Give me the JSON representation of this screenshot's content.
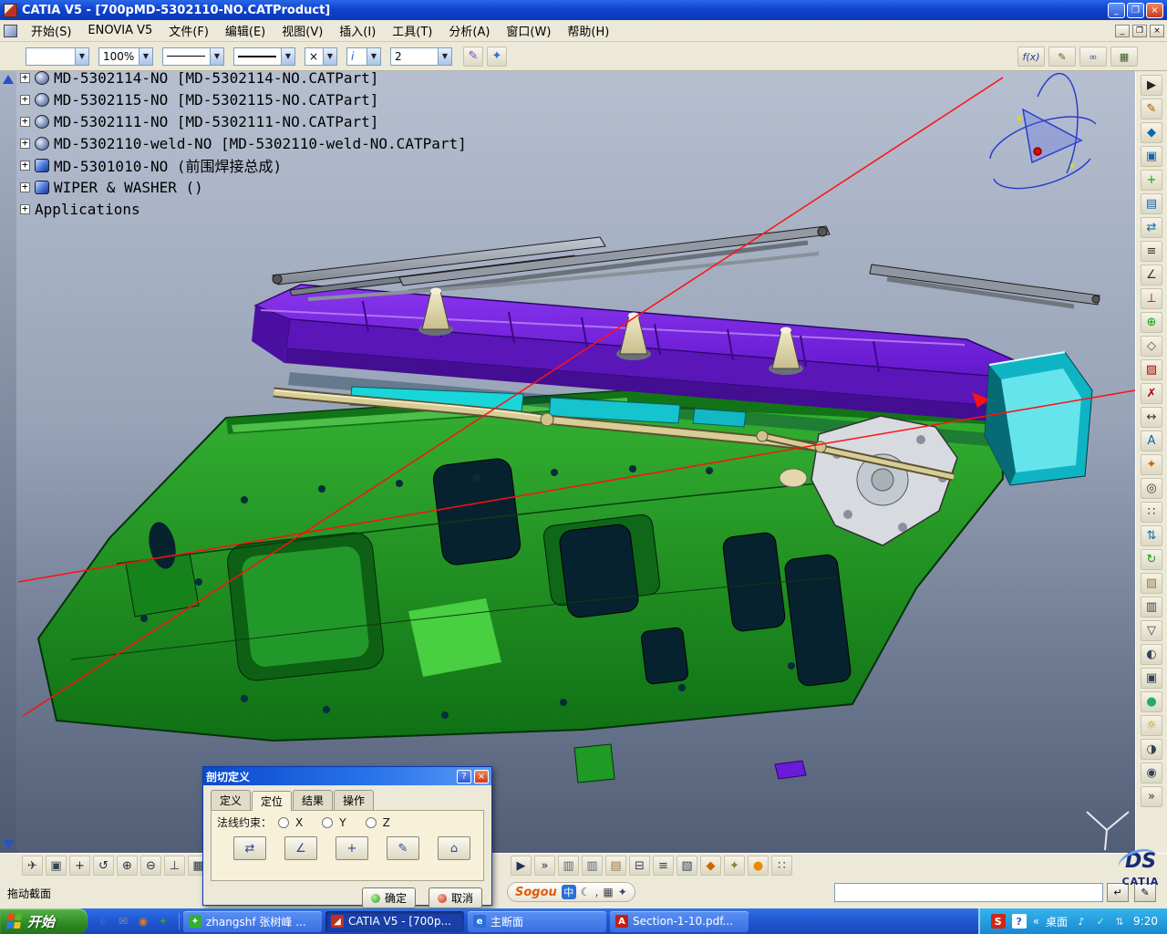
{
  "window": {
    "title": "CATIA V5 - [700pMD-5302110-NO.CATProduct]",
    "minimize": "_",
    "restore": "❐",
    "close": "×"
  },
  "menu": {
    "items": [
      "开始(S)",
      "ENOVIA V5",
      "文件(F)",
      "编辑(E)",
      "视图(V)",
      "插入(I)",
      "工具(T)",
      "分析(A)",
      "窗口(W)",
      "帮助(H)"
    ]
  },
  "toolbar": {
    "name_combo": "",
    "zoom_combo": "100%",
    "times_combo": "×",
    "info_combo": "i",
    "layer_combo": "2",
    "paint_icons": [
      {
        "name": "painter-icon",
        "glyph": "✎",
        "color": "#7a3fd0"
      },
      {
        "name": "wizard-icon",
        "glyph": "✦",
        "color": "#2a6fd0"
      }
    ],
    "right_icons": [
      {
        "name": "fx-formula-icon",
        "glyph": "f(x)",
        "color": "#1a3fa0"
      },
      {
        "name": "knowledge-icon",
        "glyph": "✎",
        "color": "#6a5a1a"
      },
      {
        "name": "link-icon",
        "glyph": "∞",
        "color": "#2a5a9a"
      },
      {
        "name": "design-table-icon",
        "glyph": "▦",
        "color": "#3a5a2a"
      }
    ]
  },
  "tree": {
    "items": [
      {
        "label": "MD-5302114-NO [MD-5302114-NO.CATPart]"
      },
      {
        "label": "MD-5302115-NO [MD-5302115-NO.CATPart]"
      },
      {
        "label": "MD-5302111-NO [MD-5302111-NO.CATPart]"
      },
      {
        "label": "MD-5302110-weld-NO [MD-5302110-weld-NO.CATPart]"
      },
      {
        "label": "MD-5301010-NO (前围焊接总成)"
      },
      {
        "label": "WIPER & WASHER ()"
      },
      {
        "label": "Applications"
      }
    ]
  },
  "right_toolbar": {
    "icons": [
      {
        "name": "select-arrow-icon",
        "glyph": "▶",
        "color": "#222222"
      },
      {
        "name": "sketch-icon",
        "glyph": "✎",
        "color": "#a05500"
      },
      {
        "name": "part-icon",
        "glyph": "◆",
        "color": "#1166aa"
      },
      {
        "name": "product-icon",
        "glyph": "▣",
        "color": "#1166aa"
      },
      {
        "name": "new-component-icon",
        "glyph": "+",
        "color": "#00aa00"
      },
      {
        "name": "existing-component-icon",
        "glyph": "▤",
        "color": "#1166aa"
      },
      {
        "name": "replace-component-icon",
        "glyph": "⇄",
        "color": "#1166aa"
      },
      {
        "name": "graph-tree-icon",
        "glyph": "≡",
        "color": "#333333"
      },
      {
        "name": "constraint-icon",
        "glyph": "∠",
        "color": "#333333"
      },
      {
        "name": "fix-constraint-icon",
        "glyph": "⊥",
        "color": "#aa0000"
      },
      {
        "name": "assemble-icon",
        "glyph": "⊕",
        "color": "#00aa00"
      },
      {
        "name": "measure-icon",
        "glyph": "◇",
        "color": "#555555"
      },
      {
        "name": "section-view-icon",
        "glyph": "▨",
        "color": "#aa0000"
      },
      {
        "name": "clash-icon",
        "glyph": "✗",
        "color": "#aa0000"
      },
      {
        "name": "distance-icon",
        "glyph": "↔",
        "color": "#333333"
      },
      {
        "name": "annotation-icon",
        "glyph": "A",
        "color": "#1166aa"
      },
      {
        "name": "weld-feature-icon",
        "glyph": "✦",
        "color": "#cc6600"
      },
      {
        "name": "hole-icon",
        "glyph": "◎",
        "color": "#333333"
      },
      {
        "name": "pattern-icon",
        "glyph": "∷",
        "color": "#333333"
      },
      {
        "name": "symmetry-icon",
        "glyph": "⇅",
        "color": "#1166aa"
      },
      {
        "name": "update-icon",
        "glyph": "↻",
        "color": "#00aa00"
      },
      {
        "name": "catalog-browser-icon",
        "glyph": "▧",
        "color": "#997744"
      },
      {
        "name": "layers-icon",
        "glyph": "▥",
        "color": "#334455"
      },
      {
        "name": "filter-icon",
        "glyph": "▽",
        "color": "#334455"
      },
      {
        "name": "scan-icon",
        "glyph": "◐",
        "color": "#334455"
      },
      {
        "name": "camera-icon",
        "glyph": "▣",
        "color": "#334455"
      },
      {
        "name": "render-icon",
        "glyph": "●",
        "color": "#22aa77"
      },
      {
        "name": "lighting-icon",
        "glyph": "☼",
        "color": "#cc8800"
      },
      {
        "name": "depth-effect-icon",
        "glyph": "◑",
        "color": "#334455"
      },
      {
        "name": "magnifier-icon",
        "glyph": "◉",
        "color": "#334455"
      },
      {
        "name": "more-tools-icon",
        "glyph": "»",
        "color": "#333333"
      }
    ]
  },
  "bottom_toolbar": {
    "left_icons": [
      {
        "name": "fly-through-icon",
        "glyph": "✈",
        "color": "#334455"
      },
      {
        "name": "fit-all-icon",
        "glyph": "▣",
        "color": "#334455"
      },
      {
        "name": "pan-icon",
        "glyph": "+",
        "color": "#223344"
      },
      {
        "name": "rotate-icon",
        "glyph": "↺",
        "color": "#223344"
      },
      {
        "name": "zoom-in-icon",
        "glyph": "⊕",
        "color": "#223344"
      },
      {
        "name": "zoom-out-icon",
        "glyph": "⊖",
        "color": "#223344"
      },
      {
        "name": "normal-view-icon",
        "glyph": "⊥",
        "color": "#223344"
      },
      {
        "name": "multi-view-icon",
        "glyph": "▦",
        "color": "#223344"
      },
      {
        "name": "shading-icon",
        "glyph": "◐",
        "color": "#223344"
      }
    ],
    "right_icons": [
      {
        "name": "play-arrow-icon",
        "glyph": "▶",
        "color": "#223355"
      },
      {
        "name": "chevrons-icon",
        "glyph": "»",
        "color": "#223355"
      },
      {
        "name": "copy-view-icon",
        "glyph": "▥",
        "color": "#556677"
      },
      {
        "name": "paste-view-icon",
        "glyph": "▥",
        "color": "#556677"
      },
      {
        "name": "new-sheet-icon",
        "glyph": "▤",
        "color": "#997744"
      },
      {
        "name": "print-icon",
        "glyph": "⊟",
        "color": "#334455"
      },
      {
        "name": "ruler-icon",
        "glyph": "≡",
        "color": "#334455"
      },
      {
        "name": "catalog-icon",
        "glyph": "▧",
        "color": "#334455"
      },
      {
        "name": "eraser-icon",
        "glyph": "◆",
        "color": "#cc6600"
      },
      {
        "name": "tools-icon",
        "glyph": "✦",
        "color": "#888833"
      },
      {
        "name": "sphere-icon",
        "glyph": "●",
        "color": "#ee8800"
      },
      {
        "name": "grid-options-icon",
        "glyph": "∷",
        "color": "#334455"
      }
    ]
  },
  "dialog": {
    "title": "剖切定义",
    "help": "?",
    "close": "×",
    "tabs": [
      "定义",
      "定位",
      "结果",
      "操作"
    ],
    "active_tab_index": 1,
    "normal_label": "法线约束：",
    "radios": [
      "X",
      "Y",
      "Z"
    ],
    "tools": [
      {
        "name": "flip-normal-button",
        "glyph": "⇄"
      },
      {
        "name": "rotate-plane-button",
        "glyph": "∠"
      },
      {
        "name": "translate-plane-button",
        "glyph": "+"
      },
      {
        "name": "edit-position-button",
        "glyph": "✎"
      },
      {
        "name": "reset-position-button",
        "glyph": "⌂"
      }
    ],
    "ok": "确定",
    "cancel": "取消"
  },
  "status": {
    "message": "拖动截面"
  },
  "sogou": {
    "brand": "Sogou",
    "mode": "中",
    "icons": [
      {
        "name": "moon-icon",
        "glyph": "☾"
      },
      {
        "name": "punctuation-icon",
        "glyph": ","
      },
      {
        "name": "keyboard-icon",
        "glyph": "▦"
      },
      {
        "name": "wrench-icon",
        "glyph": "✦"
      }
    ]
  },
  "power_input": {
    "value": ""
  },
  "mini_buttons": {
    "enter": "↵",
    "edit": "✎"
  },
  "logo": {
    "ds": "DS",
    "catia": "CATIA"
  },
  "taskbar": {
    "start": "开始",
    "quick_launch": [
      {
        "name": "ie-icon",
        "glyph": "e",
        "color": "#2a6fd8"
      },
      {
        "name": "mail-icon",
        "glyph": "✉",
        "color": "#888888"
      },
      {
        "name": "media-player-icon",
        "glyph": "◉",
        "color": "#e07820"
      },
      {
        "name": "messenger-icon",
        "glyph": "✦",
        "color": "#30a030"
      }
    ],
    "tasks": [
      {
        "label": "zhangshf 张树峰 ...",
        "glyph": "✦",
        "icon_color": "#30b030",
        "active": false
      },
      {
        "label": "CATIA V5 - [700p...",
        "glyph": "◢",
        "icon_color": "#c03020",
        "active": true
      },
      {
        "label": "主断面",
        "glyph": "e",
        "icon_color": "#2a6fd8",
        "active": false
      },
      {
        "label": "Section-1-10.pdf...",
        "glyph": "A",
        "icon_color": "#c02010",
        "active": false
      }
    ],
    "tray": {
      "sogou": "S",
      "help": "?",
      "chevron": "«",
      "desktop": "桌面",
      "icons": [
        {
          "name": "volume-icon",
          "glyph": "♪",
          "color": "#ffffff"
        },
        {
          "name": "security-icon",
          "glyph": "✓",
          "color": "#aaffaa"
        },
        {
          "name": "network-icon",
          "glyph": "⇅",
          "color": "#cce8ff"
        }
      ],
      "time": "9:20"
    }
  },
  "colors": {
    "panel_green": "#1f9a24",
    "cowl_purple": "#6a1ad8",
    "accent_cyan": "#18cfd4",
    "section_line_red": "#ff1010",
    "viewport_top": "#b6bfd0",
    "viewport_bottom": "#525e76",
    "titlebar_blue": "#0f43cf",
    "taskbar_blue": "#2258d4",
    "start_green": "#2f8a24"
  }
}
